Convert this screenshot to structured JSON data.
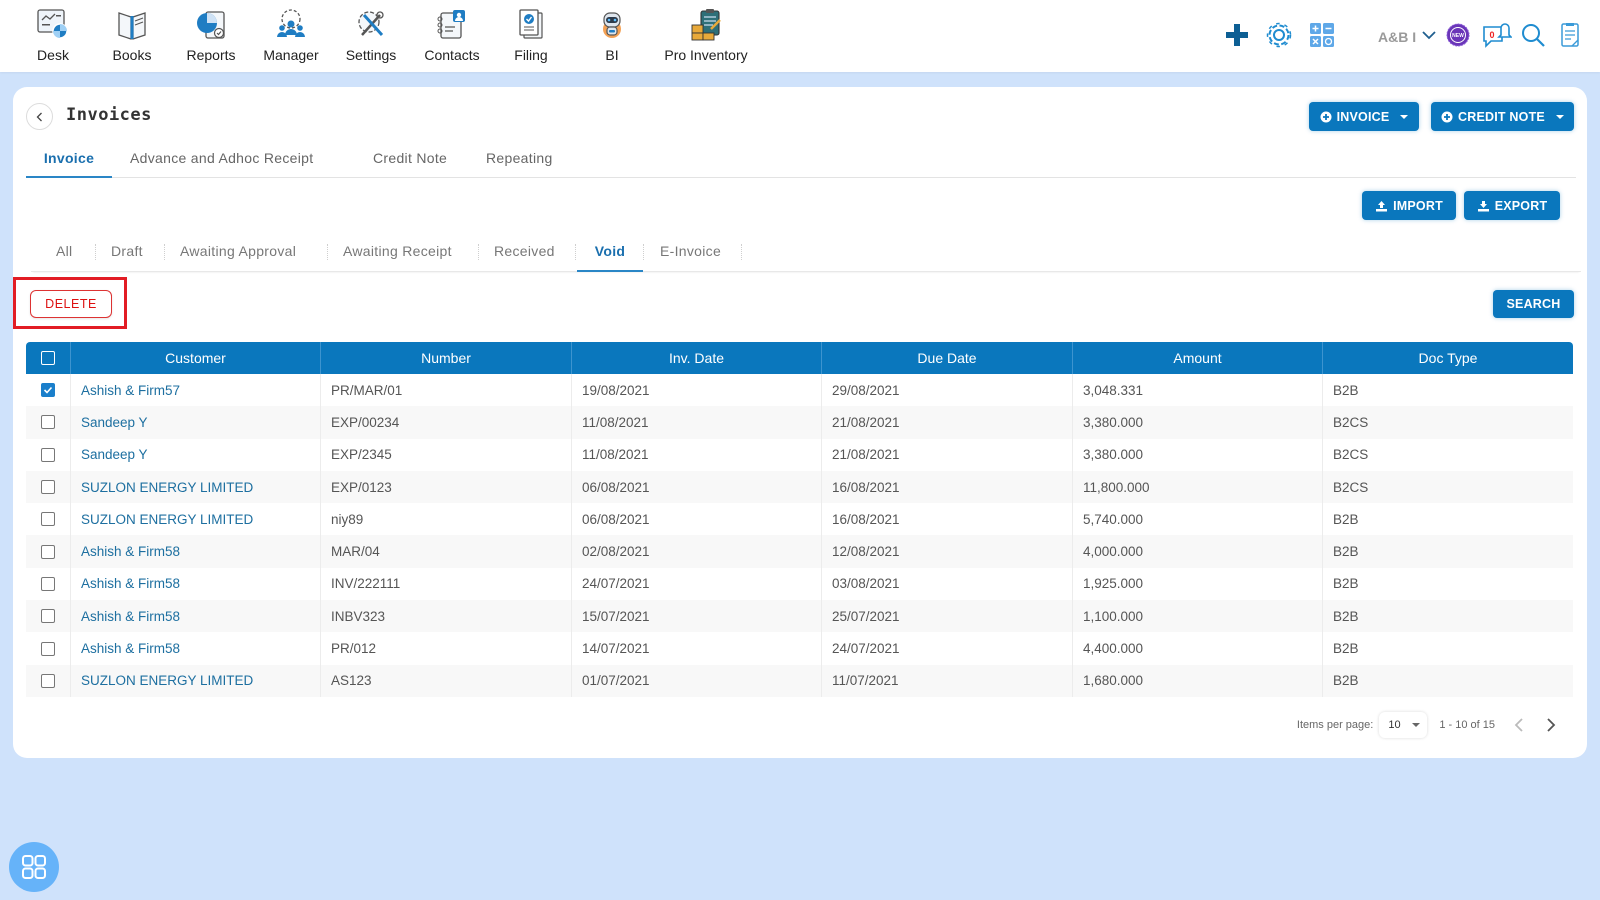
{
  "nav": {
    "items": [
      {
        "label": "Desk",
        "icon": "desk-icon"
      },
      {
        "label": "Books",
        "icon": "books-icon"
      },
      {
        "label": "Reports",
        "icon": "reports-icon"
      },
      {
        "label": "Manager",
        "icon": "manager-icon"
      },
      {
        "label": "Settings",
        "icon": "settings-icon"
      },
      {
        "label": "Contacts",
        "icon": "contacts-icon"
      },
      {
        "label": "Filing",
        "icon": "filing-icon"
      },
      {
        "label": "BI",
        "icon": "bi-robot-icon"
      },
      {
        "label": "Pro Inventory",
        "icon": "pro-inventory-icon"
      }
    ],
    "org_name": "A&B I",
    "notification_count": "0",
    "new_badge": "NEW"
  },
  "page": {
    "title": "Invoices",
    "buttons": {
      "invoice": "INVOICE",
      "credit_note": "CREDIT NOTE",
      "import": "IMPORT",
      "export": "EXPORT",
      "delete": "DELETE",
      "search": "SEARCH"
    },
    "main_tabs": [
      {
        "label": "Invoice",
        "active": true
      },
      {
        "label": "Advance and Adhoc Receipt",
        "active": false
      },
      {
        "label": "Credit Note",
        "active": false
      },
      {
        "label": "Repeating",
        "active": false
      }
    ],
    "sub_tabs": [
      {
        "label": "All",
        "active": false
      },
      {
        "label": "Draft",
        "active": false
      },
      {
        "label": "Awaiting Approval",
        "active": false
      },
      {
        "label": "Awaiting Receipt",
        "active": false
      },
      {
        "label": "Received",
        "active": false
      },
      {
        "label": "Void",
        "active": true
      },
      {
        "label": "E-Invoice",
        "active": false
      }
    ]
  },
  "table": {
    "columns": [
      "Customer",
      "Number",
      "Inv. Date",
      "Due Date",
      "Amount",
      "Doc Type"
    ],
    "rows": [
      {
        "checked": true,
        "customer": "Ashish & Firm57",
        "number": "PR/MAR/01",
        "inv_date": "19/08/2021",
        "due_date": "29/08/2021",
        "amount": "3,048.331",
        "doc_type": "B2B"
      },
      {
        "checked": false,
        "customer": "Sandeep Y",
        "number": "EXP/00234",
        "inv_date": "11/08/2021",
        "due_date": "21/08/2021",
        "amount": "3,380.000",
        "doc_type": "B2CS"
      },
      {
        "checked": false,
        "customer": "Sandeep Y",
        "number": "EXP/2345",
        "inv_date": "11/08/2021",
        "due_date": "21/08/2021",
        "amount": "3,380.000",
        "doc_type": "B2CS"
      },
      {
        "checked": false,
        "customer": "SUZLON ENERGY LIMITED",
        "number": "EXP/0123",
        "inv_date": "06/08/2021",
        "due_date": "16/08/2021",
        "amount": "11,800.000",
        "doc_type": "B2CS"
      },
      {
        "checked": false,
        "customer": "SUZLON ENERGY LIMITED",
        "number": "niy89",
        "inv_date": "06/08/2021",
        "due_date": "16/08/2021",
        "amount": "5,740.000",
        "doc_type": "B2B"
      },
      {
        "checked": false,
        "customer": "Ashish & Firm58",
        "number": "MAR/04",
        "inv_date": "02/08/2021",
        "due_date": "12/08/2021",
        "amount": "4,000.000",
        "doc_type": "B2B"
      },
      {
        "checked": false,
        "customer": "Ashish & Firm58",
        "number": "INV/222111",
        "inv_date": "24/07/2021",
        "due_date": "03/08/2021",
        "amount": "1,925.000",
        "doc_type": "B2B"
      },
      {
        "checked": false,
        "customer": "Ashish & Firm58",
        "number": "INBV323",
        "inv_date": "15/07/2021",
        "due_date": "25/07/2021",
        "amount": "1,100.000",
        "doc_type": "B2B"
      },
      {
        "checked": false,
        "customer": "Ashish & Firm58",
        "number": "PR/012",
        "inv_date": "14/07/2021",
        "due_date": "24/07/2021",
        "amount": "4,400.000",
        "doc_type": "B2B"
      },
      {
        "checked": false,
        "customer": "SUZLON ENERGY LIMITED",
        "number": "AS123",
        "inv_date": "01/07/2021",
        "due_date": "11/07/2021",
        "amount": "1,680.000",
        "doc_type": "B2B"
      }
    ]
  },
  "pagination": {
    "items_per_page_label": "Items per page:",
    "items_per_page": "10",
    "range": "1 - 10 of 15"
  },
  "colors": {
    "primary": "#0a77bd",
    "danger": "#e21c24",
    "background": "#cfe2fb"
  }
}
